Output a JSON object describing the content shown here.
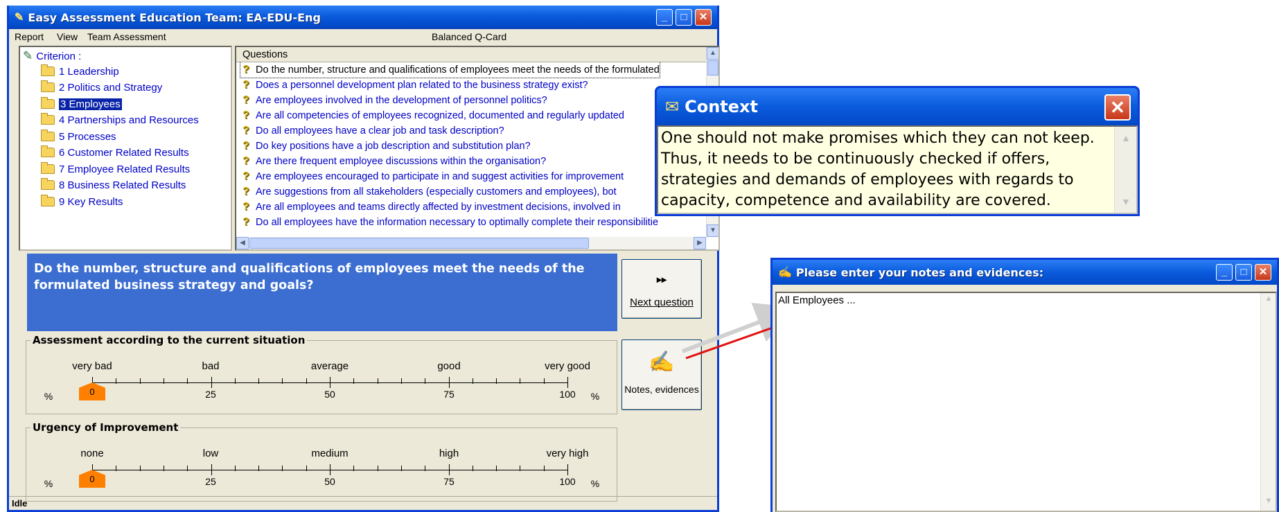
{
  "main_window": {
    "title": "Easy Assessment Education Team: EA-EDU-Eng",
    "menu": [
      "Report",
      "View",
      "Team Assessment"
    ],
    "toolbar_label": "Balanced Q-Card",
    "criterion_header": "Criterion :",
    "criteria": [
      "1 Leadership",
      "2 Politics and Strategy",
      "3 Employees",
      "4 Partnerships and Resources",
      "5 Processes",
      "6 Customer Related Results",
      "7 Employee Related Results",
      "8 Business Related Results",
      "9 Key Results"
    ],
    "selected_criterion_index": 2,
    "questions_header": "Questions",
    "questions": [
      "Do the number, structure and qualifications of employees meet the needs of the formulated",
      "Does a personnel development plan related to the business strategy exist?",
      "Are employees involved in the development of personnel politics?",
      "Are all competencies of employees recognized, documented and regularly updated",
      "Do all employees have a clear job and task description?",
      "Do key positions have a job description and substitution plan?",
      "Are there frequent employee discussions within the organisation?",
      "Are employees encouraged to participate in and suggest activities for improvement",
      "Are suggestions from all stakeholders (especially customers and employees), bot",
      "Are all employees and teams directly affected by investment decisions, involved in",
      "Do all employees have the information necessary to optimally complete their responsibilitie"
    ],
    "current_question": "Do the number, structure and qualifications of employees meet the needs of the formulated business strategy and goals?",
    "next_button": {
      "icon": "▸▸",
      "label": "Next question"
    },
    "notes_button_label": "Notes, evidences",
    "assessment": {
      "legend": "Assessment according to the current situation",
      "labels": [
        "very bad",
        "bad",
        "average",
        "good",
        "very good"
      ],
      "numbers": [
        "25",
        "50",
        "75",
        "100"
      ],
      "percent_sign": "%",
      "value": "0"
    },
    "urgency": {
      "legend": "Urgency of Improvement",
      "labels": [
        "none",
        "low",
        "medium",
        "high",
        "very high"
      ],
      "numbers": [
        "25",
        "50",
        "75",
        "100"
      ],
      "percent_sign": "%",
      "value": "0"
    },
    "status": "Idle"
  },
  "context_popup": {
    "title": "Context",
    "text": "One should not make promises which they can not keep. Thus, it needs to be continuously checked if offers, strategies and demands of employees with regards to capacity, competence and availability are covered."
  },
  "notes_window": {
    "title": "Please enter your notes and evidences:",
    "content": "All Employees ..."
  },
  "colors": {
    "xp_blue": "#0a5bdc",
    "question_bg": "#3b6ed0",
    "marker": "#ff8000",
    "context_bg": "#ffffe1",
    "arrow_red": "#e01010"
  }
}
